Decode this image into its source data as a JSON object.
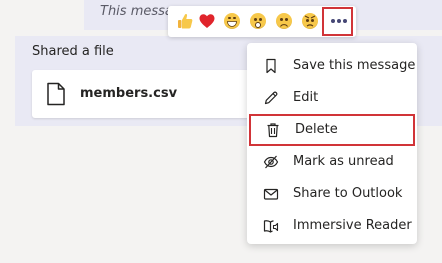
{
  "message": {
    "text": "This message"
  },
  "shared_file": {
    "title": "Shared a file",
    "file_name": "members.csv",
    "icon": "document-icon"
  },
  "reactions": [
    {
      "name": "like",
      "icon": "thumbs-up-icon"
    },
    {
      "name": "heart",
      "icon": "heart-icon"
    },
    {
      "name": "laugh",
      "icon": "laugh-icon"
    },
    {
      "name": "surprised",
      "icon": "surprised-icon"
    },
    {
      "name": "sad",
      "icon": "sad-icon"
    },
    {
      "name": "angry",
      "icon": "angry-icon"
    }
  ],
  "more_options": {
    "icon": "more-options-icon",
    "highlight_color": "#d13438"
  },
  "menu": {
    "items": [
      {
        "label": "Save this message",
        "icon": "bookmark-icon"
      },
      {
        "label": "Edit",
        "icon": "pencil-icon"
      },
      {
        "label": "Delete",
        "icon": "trash-icon",
        "highlighted": true
      },
      {
        "label": "Mark as unread",
        "icon": "unread-icon"
      },
      {
        "label": "Share to Outlook",
        "icon": "mail-icon"
      },
      {
        "label": "Immersive Reader",
        "icon": "immersive-reader-icon"
      }
    ]
  },
  "colors": {
    "background": "#f4f3f2",
    "bubble": "#e9e9f4",
    "accent": "#464775",
    "highlight": "#d13438"
  }
}
